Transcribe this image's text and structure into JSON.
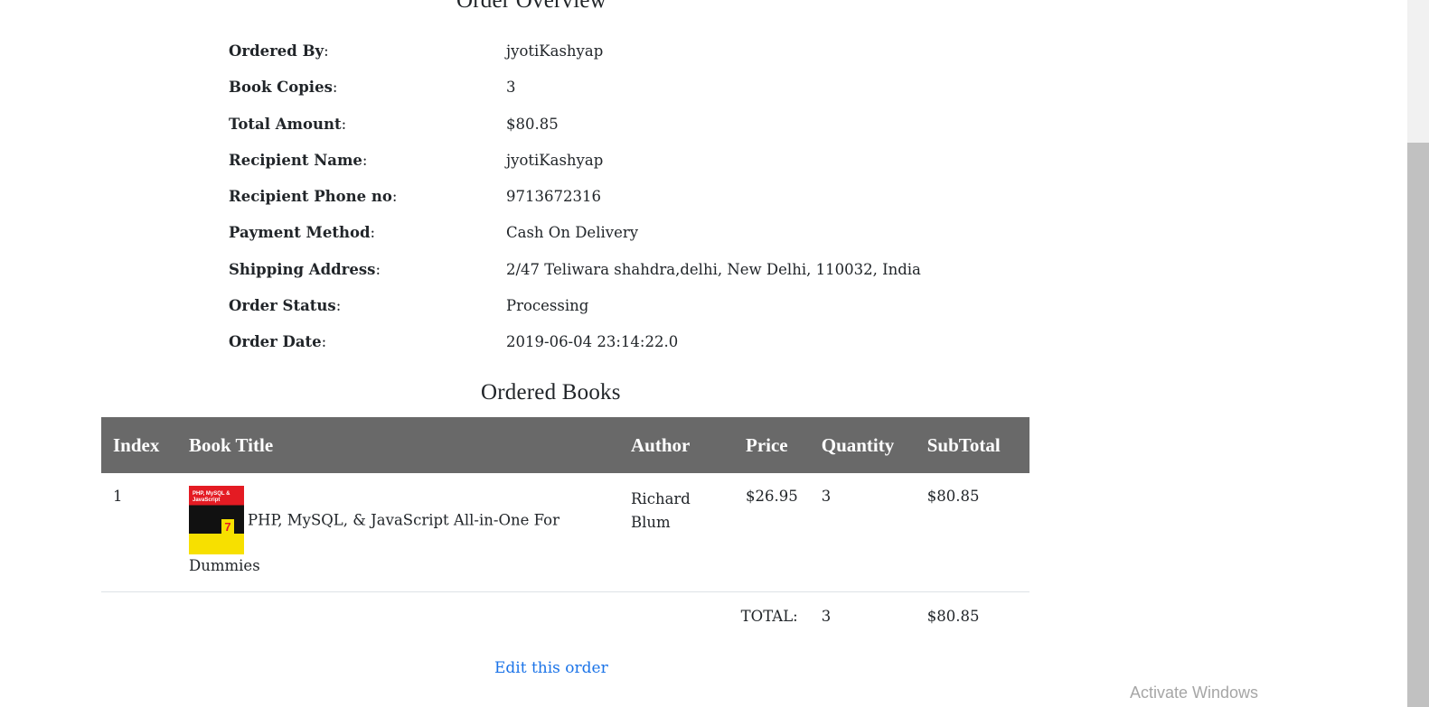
{
  "overview": {
    "title": "Order Overview",
    "rows": [
      {
        "label": "Ordered By",
        "value": "jyotiKashyap"
      },
      {
        "label": "Book Copies",
        "value": "3"
      },
      {
        "label": "Total Amount",
        "value": "$80.85"
      },
      {
        "label": "Recipient Name",
        "value": "jyotiKashyap"
      },
      {
        "label": "Recipient Phone no",
        "value": "9713672316"
      },
      {
        "label": "Payment Method",
        "value": "Cash On Delivery"
      },
      {
        "label": "Shipping Address",
        "value": "2/47 Teliwara shahdra,delhi, New Delhi, 110032, India"
      },
      {
        "label": "Order Status",
        "value": "Processing"
      },
      {
        "label": "Order Date",
        "value": "2019-06-04 23:14:22.0"
      }
    ]
  },
  "books": {
    "title": "Ordered Books",
    "headers": {
      "index": "Index",
      "title": "Book Title",
      "author": "Author",
      "price": "Price",
      "quantity": "Quantity",
      "subtotal": "SubTotal"
    },
    "items": [
      {
        "index": "1",
        "title": "PHP, MySQL, & JavaScript All-in-One For Dummies",
        "author": "Richard Blum",
        "price": "$26.95",
        "quantity": "3",
        "subtotal": "$80.85",
        "cover": {
          "text": "PHP, MySQL & JavaScript",
          "badge": "7"
        }
      }
    ],
    "total": {
      "label": "TOTAL:",
      "quantity": "3",
      "subtotal": "$80.85"
    }
  },
  "actions": {
    "edit_label": "Edit this order"
  },
  "os": {
    "watermark": "Activate Windows"
  },
  "colors": {
    "header_bg": "#696969",
    "link": "#1a73e8"
  }
}
